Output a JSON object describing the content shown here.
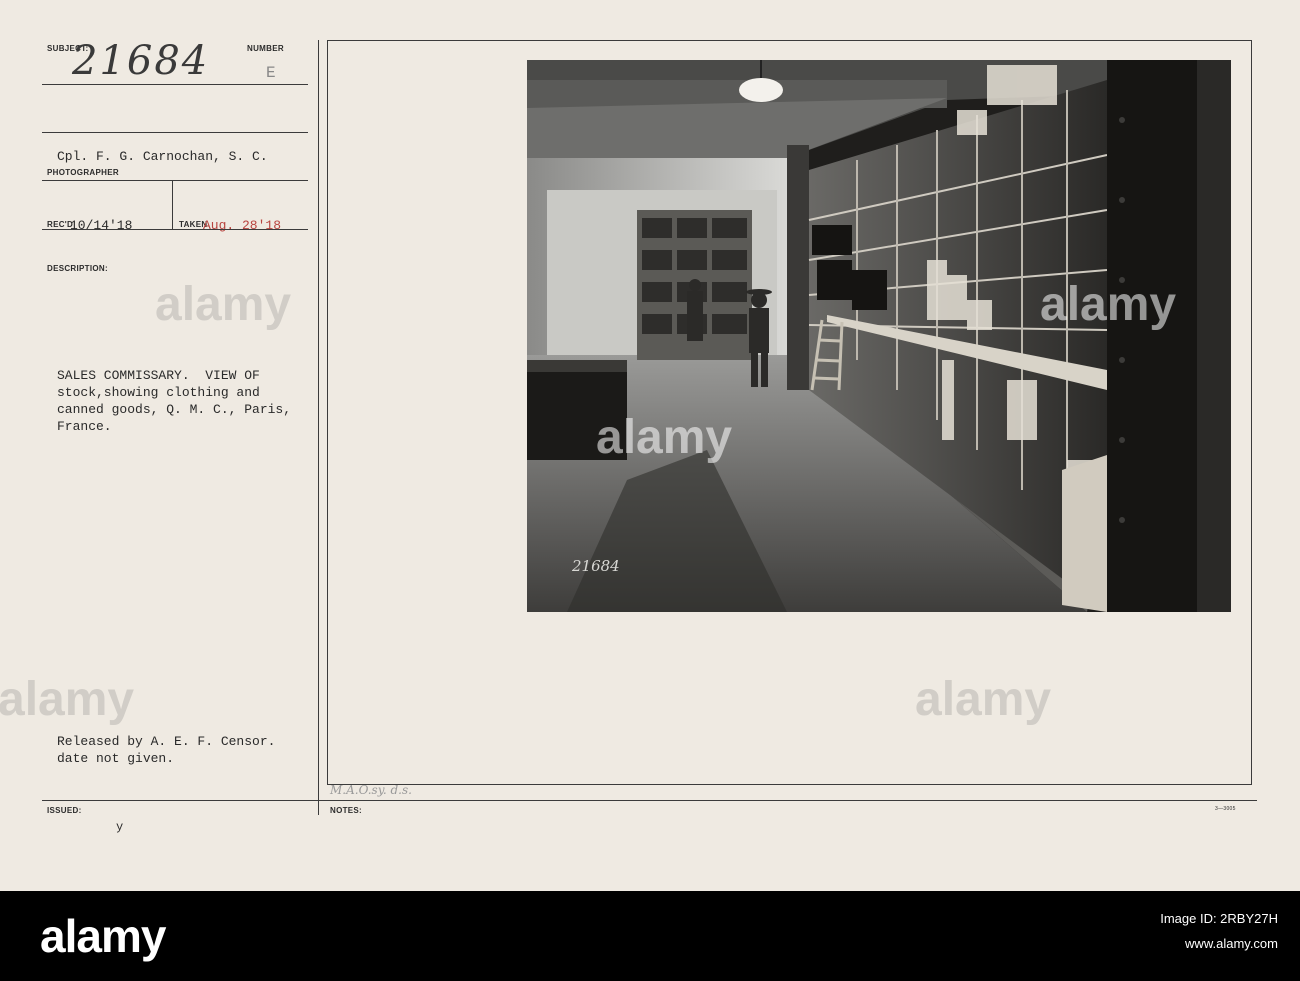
{
  "form": {
    "subject_label": "SUBJECT:",
    "number_label": "NUMBER",
    "subject_value": "21684",
    "number_value": "E",
    "photographer_value": "Cpl. F. G. Carnochan, S. C.",
    "photographer_label": "PHOTOGRAPHER",
    "recd_label": "REC'D",
    "recd_value": "10/14'18",
    "taken_label": "TAKEN",
    "taken_value": "Aug. 28'18",
    "description_label": "DESCRIPTION:",
    "description_lines": [
      "SALES COMMISSARY.  VIEW OF",
      "stock,showing clothing and",
      "canned goods, Q. M. C., Paris,",
      "France."
    ],
    "released_lines": [
      "Released by A. E. F. Censor.",
      "date not given."
    ],
    "issued_label": "ISSUED:",
    "issued_value": "y",
    "notes_label": "NOTES:",
    "notes_handwriting": "M.A.O.sy. d.s.",
    "form_number": "3—3005"
  },
  "photo": {
    "caption_number": "21684"
  },
  "watermark": {
    "text": "alamy"
  },
  "footer": {
    "brand": "alamy",
    "image_id": "Image ID: 2RBY27H",
    "site": "www.alamy.com"
  }
}
